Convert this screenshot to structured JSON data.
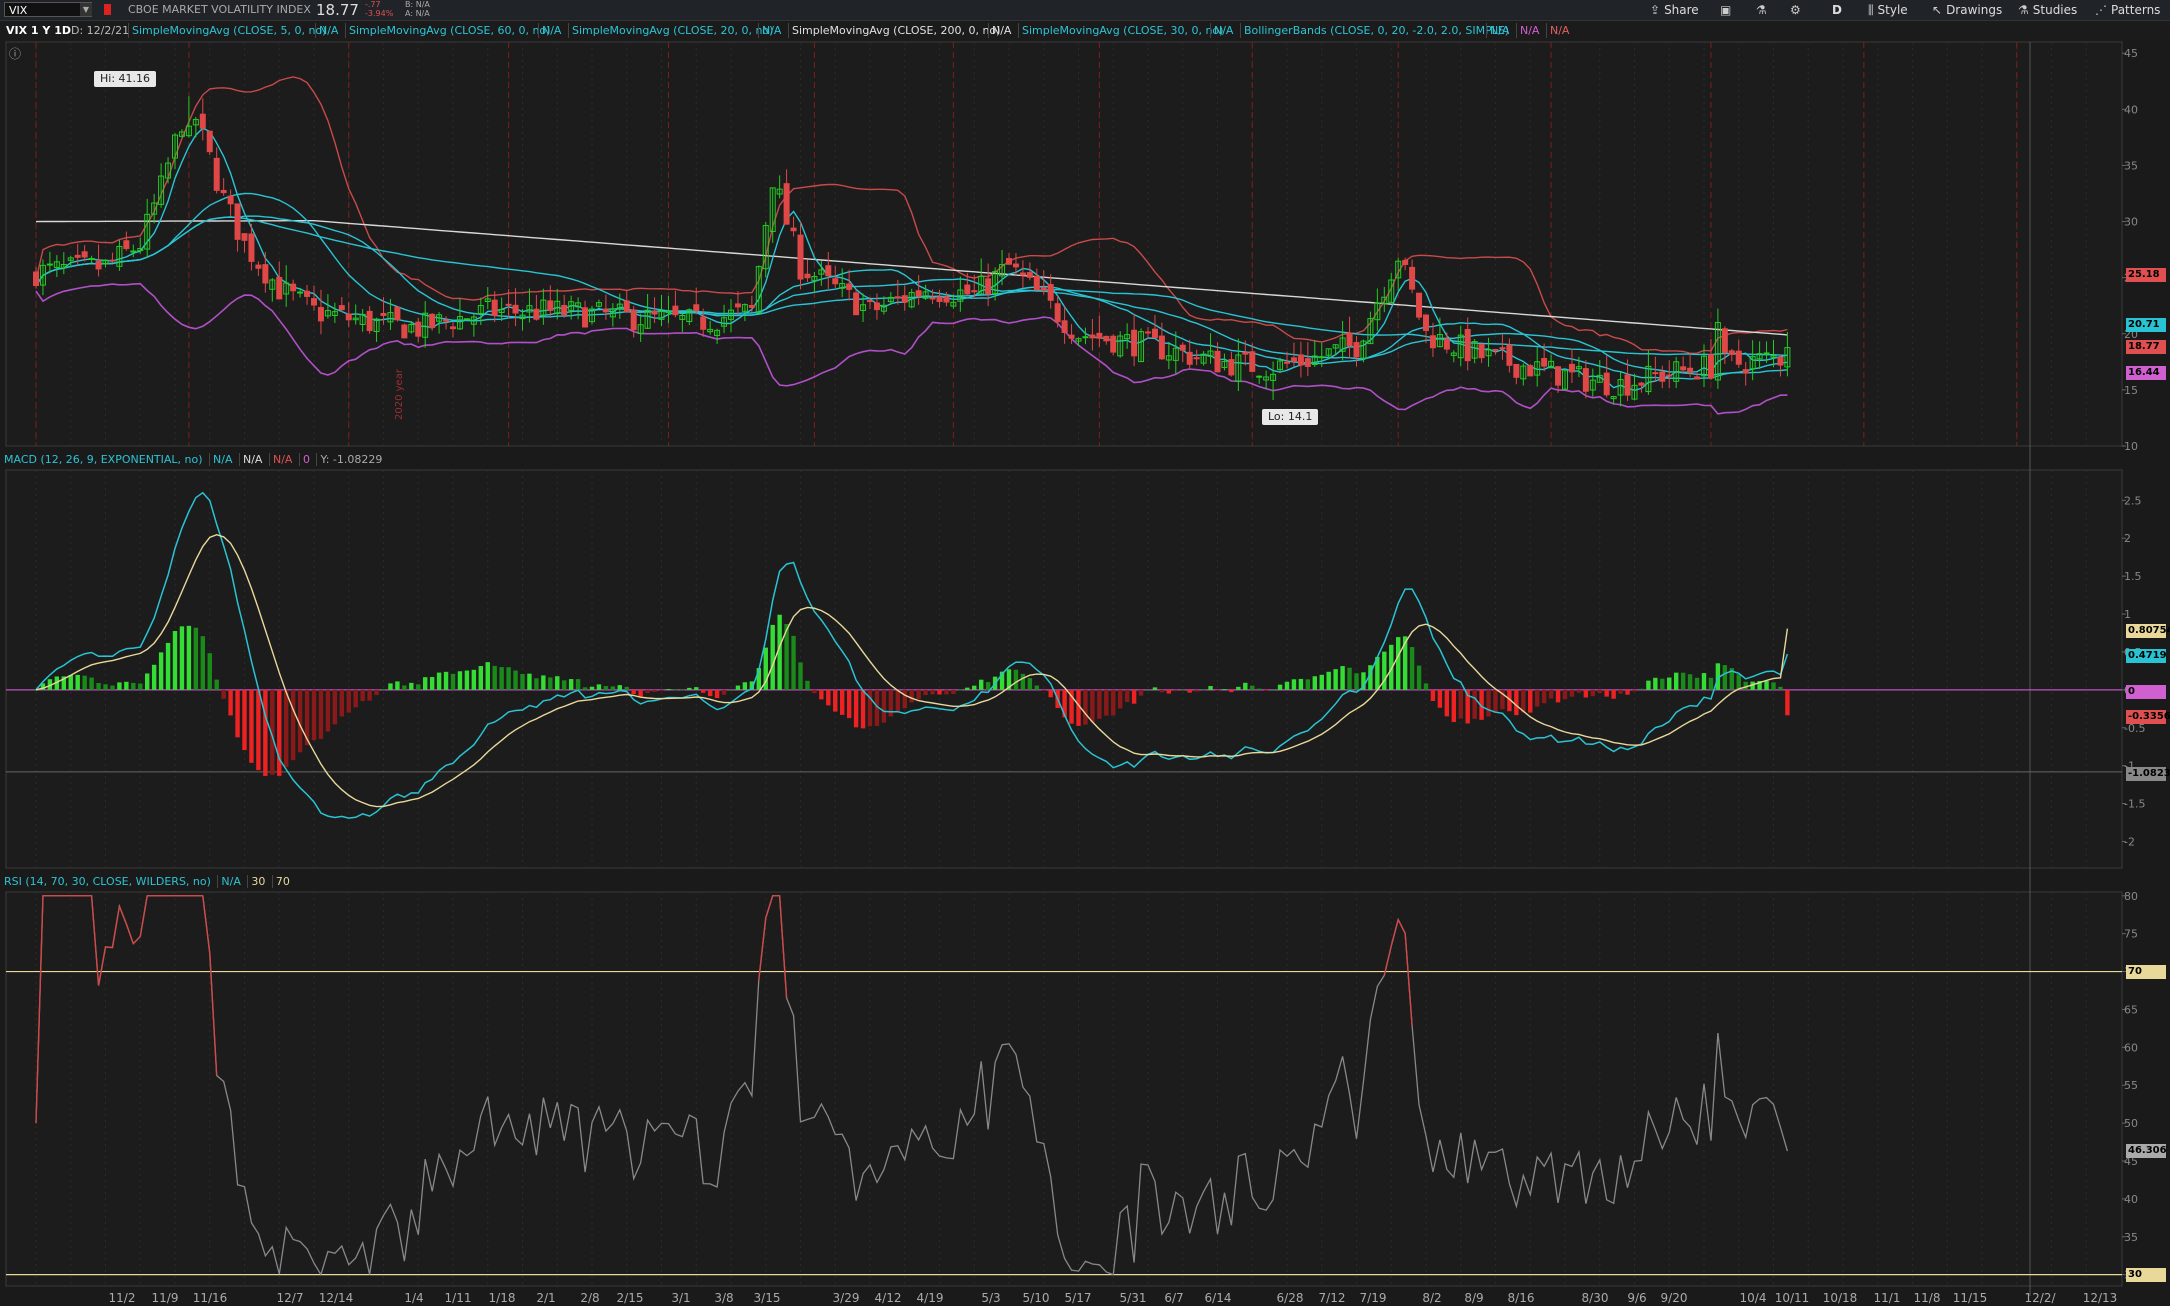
{
  "toolbar": {
    "symbol": "VIX",
    "symbol_name": "CBOE MARKET VOLATILITY INDEX",
    "last": "18.77",
    "change": "-.77",
    "change_pct": "-3.94%",
    "bid": "B: N/A",
    "ask": "A: N/A",
    "buttons": {
      "share": "Share",
      "aggregation": "D",
      "style": "Style",
      "drawings": "Drawings",
      "studies": "Studies",
      "patterns": "Patterns"
    }
  },
  "studies": {
    "title": "VIX 1 Y 1D",
    "date": "D: 12/2/21",
    "sma5": "SimpleMovingAvg (CLOSE, 5, 0, no)",
    "sma60": "SimpleMovingAvg (CLOSE, 60, 0, no)",
    "sma20": "SimpleMovingAvg (CLOSE, 20, 0, no)",
    "sma200": "SimpleMovingAvg (CLOSE, 200, 0, no)",
    "sma30": "SimpleMovingAvg (CLOSE, 30, 0, no)",
    "bb": "BollingerBands (CLOSE, 0, 20, -2.0, 2.0, SIMPLE)",
    "na": "N/A"
  },
  "macd": {
    "label": "MACD (12, 26, 9, EXPONENTIAL, no)",
    "na": "N/A",
    "zero": "0",
    "cursor": "Y: -1.08229",
    "ticks": [
      "2.5",
      "2",
      "1.5",
      "1",
      "0.5",
      "0",
      "-0.5",
      "-1",
      "-1.5",
      "-2"
    ],
    "value": "0.80754",
    "avg": "0.4719",
    "zero_box": "0",
    "diff": "-0.3356",
    "crosshair": "-1.0823"
  },
  "rsi": {
    "label": "RSI (14, 70, 30, CLOSE, WILDERS, no)",
    "na": "N/A",
    "ob": "30",
    "os": "70",
    "ticks": [
      "80",
      "75",
      "70",
      "65",
      "60",
      "55",
      "50",
      "45",
      "40",
      "35",
      "30"
    ],
    "ob_box": "70",
    "os_box": "30",
    "value": "46.306"
  },
  "price": {
    "ticks": [
      "45",
      "40",
      "35",
      "30",
      "25",
      "20",
      "15",
      "10"
    ],
    "hi_label": "Hi: 41.16",
    "lo_label": "Lo: 14.1",
    "bb_upper": "25.18",
    "sma": "20.71",
    "last": "18.77",
    "bb_lower": "16.44"
  },
  "x_axis": {
    "labels": [
      "11/2",
      "11/9",
      "11/16",
      "12/7",
      "12/14",
      "1/4",
      "1/11",
      "1/18",
      "2/1",
      "2/8",
      "2/15",
      "3/1",
      "3/8",
      "3/15",
      "3/29",
      "4/12",
      "4/19",
      "5/3",
      "5/10",
      "5/17",
      "5/31",
      "6/7",
      "6/14",
      "6/28",
      "7/12",
      "7/19",
      "8/2",
      "8/9",
      "8/16",
      "8/30",
      "9/6",
      "9/20",
      "10/4",
      "10/11",
      "10/18",
      "11/1",
      "11/8",
      "11/15",
      "12/2/",
      "12/13"
    ],
    "year_marker": "2020 year"
  },
  "chart_data": {
    "type": "candlestick",
    "price_range": [
      10,
      46
    ],
    "high": 41.16,
    "low": 14.1,
    "last": 18.77,
    "bb_upper_last": 25.18,
    "bb_lower_last": 16.44,
    "sma_last": 20.71,
    "macd_range": [
      -2.35,
      2.9
    ],
    "macd_value": 0.80754,
    "macd_avg": 0.4719,
    "macd_diff": -0.3356,
    "rsi_range": [
      28.5,
      80.5
    ],
    "rsi_overbought": 70,
    "rsi_oversold": 30,
    "rsi_last": 46.306
  },
  "colors": {
    "bull": "#22cc22",
    "bear": "#e04848",
    "cyan": "#29c4d4",
    "macdavg": "#e8d89a",
    "bb_upper": "#c84a4a",
    "bb_lower": "#b050c8",
    "sma200": "#d8d8d8",
    "rsi": "#888888"
  }
}
